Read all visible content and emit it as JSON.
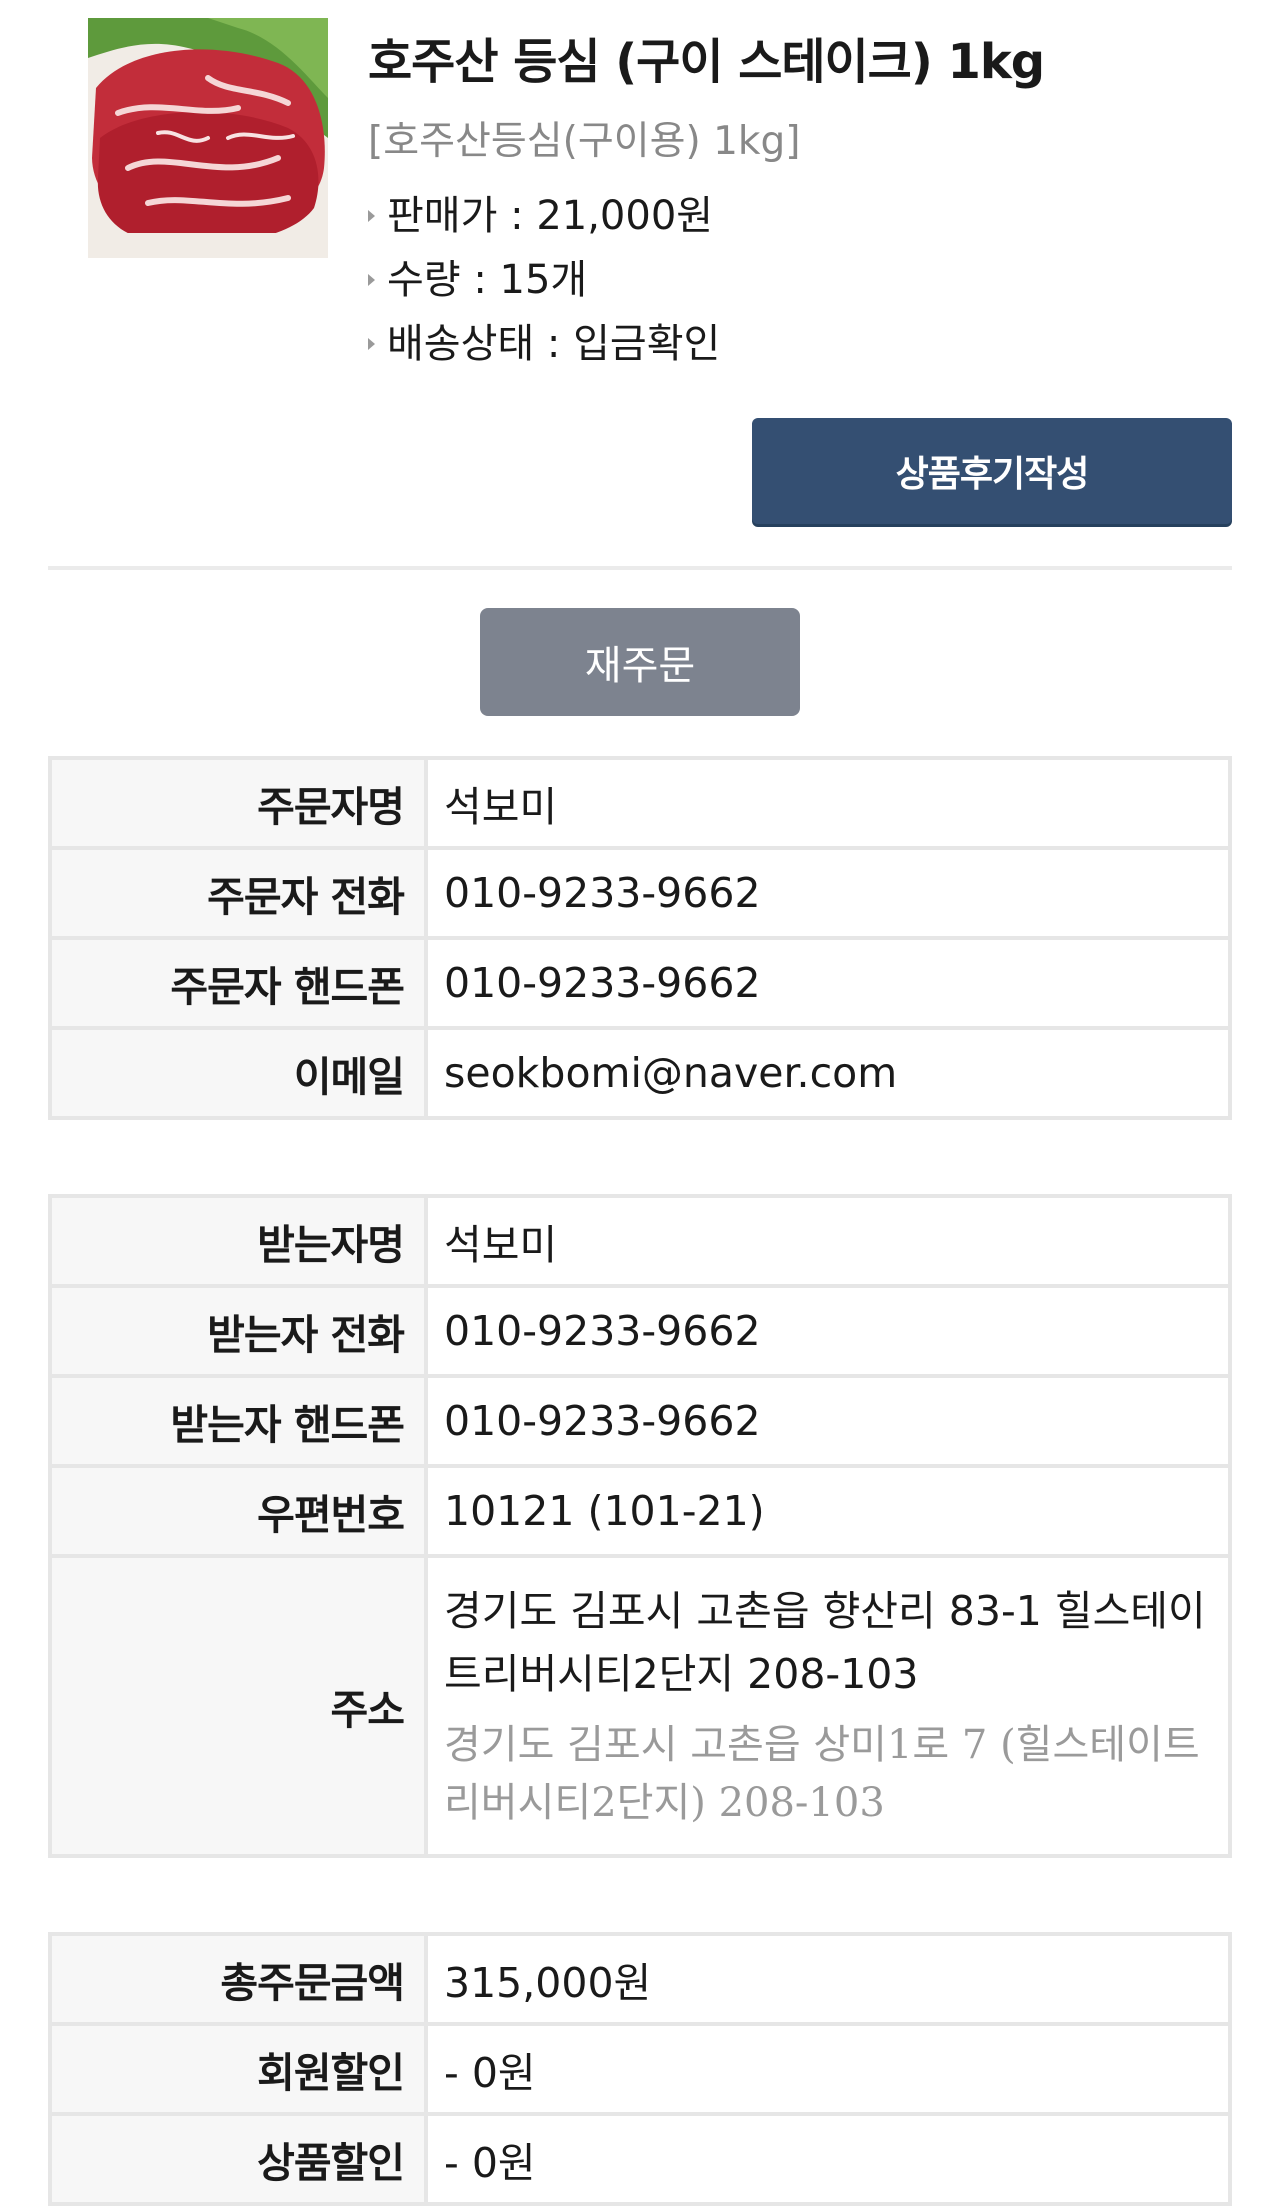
{
  "product": {
    "image_icon": "beef-steak-image",
    "name": "호주산 등심 (구이 스테이크) 1kg",
    "option": "[호주산등심(구이용) 1kg]",
    "info": [
      {
        "label": "판매가",
        "value": "21,000원"
      },
      {
        "label": "수량",
        "value": "15개"
      },
      {
        "label": "배송상태",
        "value": "입금확인"
      }
    ],
    "review_button": "상품후기작성"
  },
  "reorder_button": "재주문",
  "orderer": [
    {
      "label": "주문자명",
      "value": "석보미"
    },
    {
      "label": "주문자 전화",
      "value": "010-9233-9662"
    },
    {
      "label": "주문자 핸드폰",
      "value": "010-9233-9662"
    },
    {
      "label": "이메일",
      "value": "seokbomi@naver.com"
    }
  ],
  "receiver": {
    "name_label": "받는자명",
    "name": "석보미",
    "phone_label": "받는자 전화",
    "phone": "010-9233-9662",
    "mobile_label": "받는자 핸드폰",
    "mobile": "010-9233-9662",
    "zip_label": "우편번호",
    "zip": "10121 (101-21)",
    "address_label": "주소",
    "address_lot": "경기도 김포시 고촌읍 향산리 83-1 힐스테이트리버시티2단지 208-103",
    "address_road": "경기도 김포시 고촌읍 상미1로 7 (힐스테이트리버시티2단지) 208-103"
  },
  "payment": [
    {
      "label": "총주문금액",
      "value": "315,000원"
    },
    {
      "label": "회원할인",
      "value": "- 0원"
    },
    {
      "label": "상품할인",
      "value": "- 0원"
    }
  ],
  "colors": {
    "review_button_bg": "#344f72",
    "reorder_button_bg": "#7d838f",
    "table_header_bg": "#f7f7f7",
    "table_border": "#e6e6e6"
  }
}
